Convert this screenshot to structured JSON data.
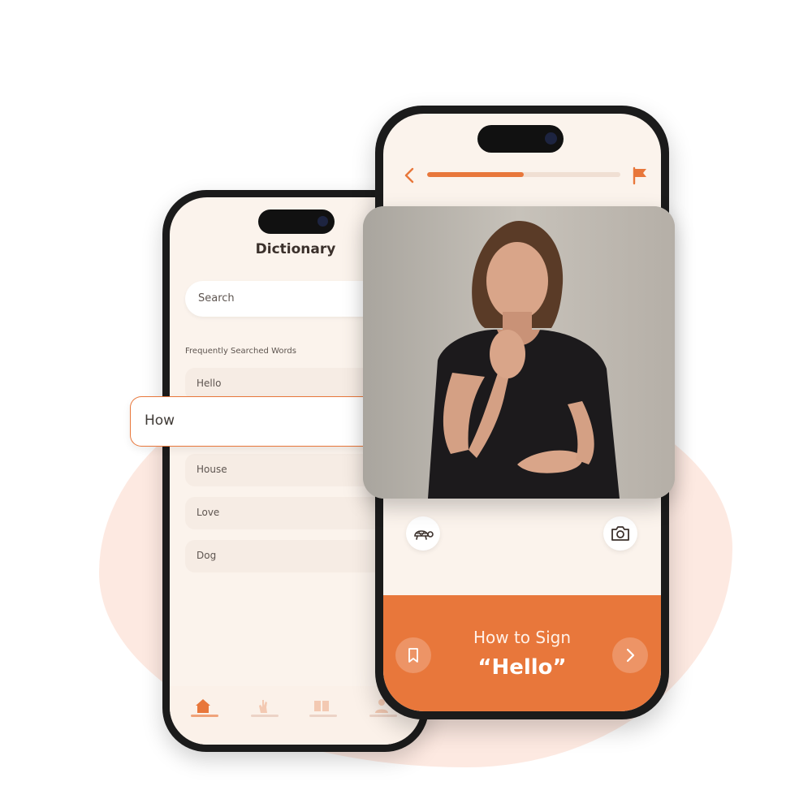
{
  "dictionary": {
    "title": "Dictionary",
    "search_placeholder": "Search",
    "section_label": "Frequently Searched Words",
    "words": [
      "Hello",
      "House",
      "Love",
      "Dog"
    ],
    "highlighted_word": "How",
    "tabs": [
      "home-icon",
      "hand-icon",
      "book-icon",
      "profile-icon"
    ],
    "active_tab": "home-icon"
  },
  "lesson": {
    "progress": 0.5,
    "heading": "How to Sign",
    "word": "“Hello”"
  },
  "colors": {
    "accent": "#e8773b",
    "background_cream": "#fbf3ec",
    "blob": "#fde9e1"
  }
}
